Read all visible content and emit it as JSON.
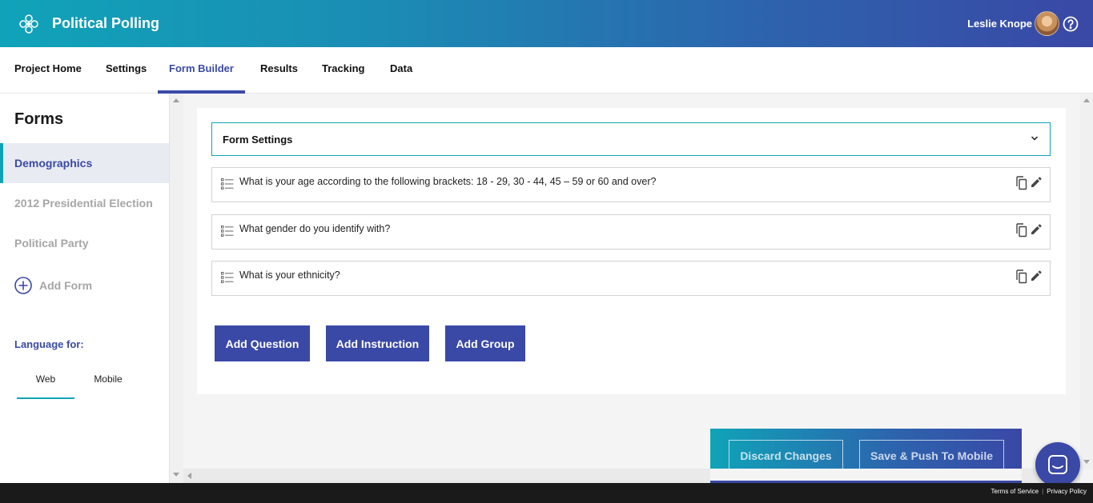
{
  "header": {
    "app_title": "Political Polling",
    "user_name": "Leslie Knope",
    "logo_icon": "flower-logo-icon",
    "help_icon": "help-circle-icon"
  },
  "nav": {
    "tabs": [
      {
        "label": "Project Home"
      },
      {
        "label": "Settings"
      },
      {
        "label": "Form Builder",
        "active": true
      },
      {
        "label": "Results"
      },
      {
        "label": "Tracking"
      },
      {
        "label": "Data"
      }
    ]
  },
  "sidebar": {
    "title": "Forms",
    "forms": [
      {
        "label": "Demographics",
        "active": true
      },
      {
        "label": "2012 Presidential Election"
      },
      {
        "label": "Political Party"
      }
    ],
    "add_form_label": "Add Form",
    "language_label": "Language for:",
    "language_tabs": [
      {
        "label": "Web",
        "active": true
      },
      {
        "label": "Mobile"
      }
    ]
  },
  "form": {
    "settings_label": "Form Settings",
    "questions": [
      {
        "text": "What is your age according to the following brackets: 18 - 29, 30 - 44, 45 – 59 or 60 and over?"
      },
      {
        "text": "What gender do you identify with?"
      },
      {
        "text": "What is your ethnicity?"
      }
    ],
    "buttons": {
      "add_question": "Add Question",
      "add_instruction": "Add Instruction",
      "add_group": "Add Group"
    }
  },
  "actions": {
    "discard": "Discard Changes",
    "save_push": "Save & Push To Mobile"
  },
  "footer": {
    "terms": "Terms of Service",
    "privacy": "Privacy Policy"
  },
  "colors": {
    "accent": "#3a48a6",
    "teal": "#10a3b8"
  }
}
